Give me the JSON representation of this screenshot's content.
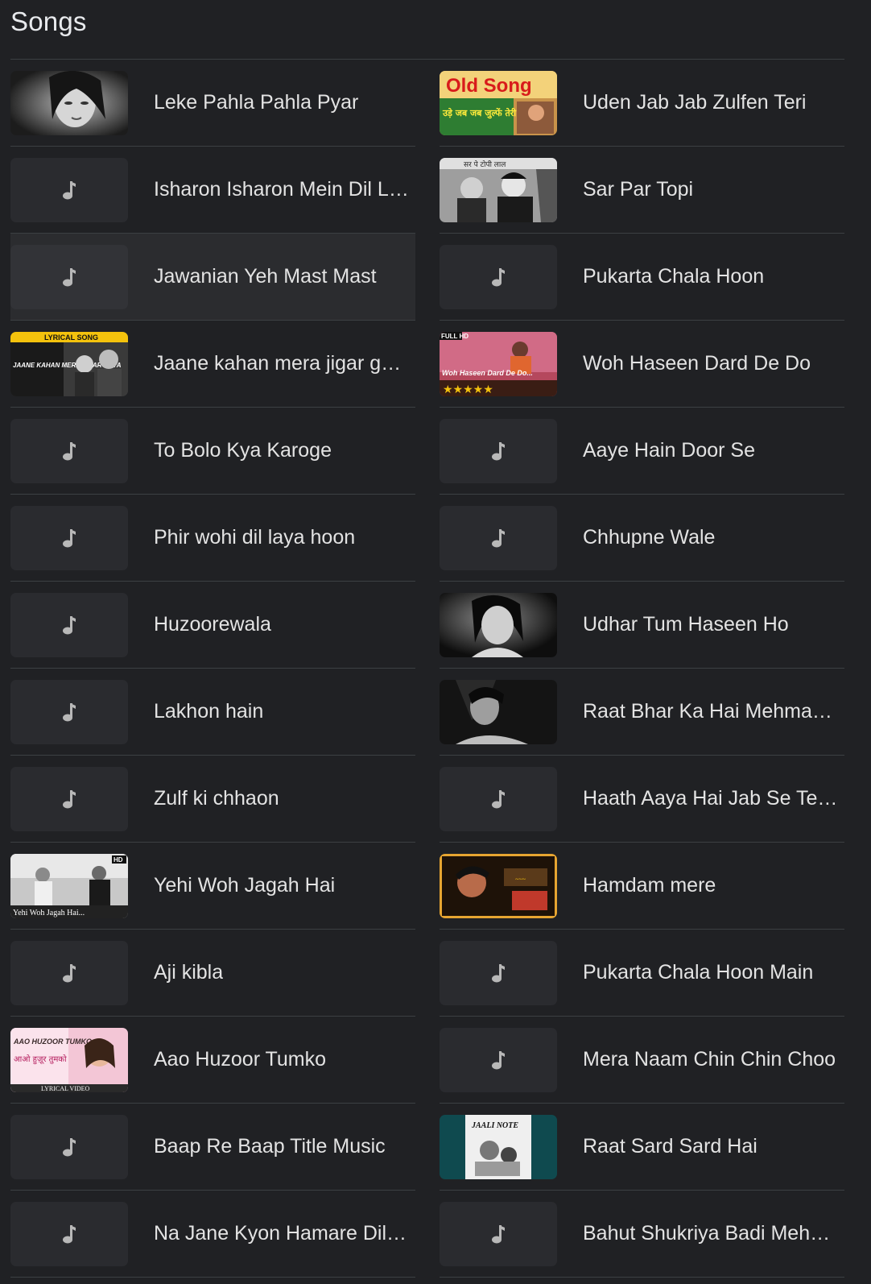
{
  "page": {
    "title": "Songs"
  },
  "songs_left": [
    {
      "title": "Leke Pahla Pahla Pyar"
    },
    {
      "title": "Isharon Isharon Mein Dil Le Jane Wale"
    },
    {
      "title": "Jawanian Yeh Mast Mast"
    },
    {
      "title": "Jaane kahan mera jigar gaya ji"
    },
    {
      "title": "To Bolo Kya Karoge"
    },
    {
      "title": "Phir wohi dil laya hoon"
    },
    {
      "title": "Huzoorewala"
    },
    {
      "title": "Lakhon hain"
    },
    {
      "title": "Zulf ki chhaon"
    },
    {
      "title": "Yehi Woh Jagah Hai"
    },
    {
      "title": "Aji kibla"
    },
    {
      "title": "Aao Huzoor Tumko"
    },
    {
      "title": "Baap Re Baap Title Music"
    },
    {
      "title": "Na Jane Kyon Hamare Dil Ko"
    }
  ],
  "songs_right": [
    {
      "title": "Uden Jab Jab Zulfen Teri"
    },
    {
      "title": "Sar Par Topi"
    },
    {
      "title": "Pukarta Chala Hoon"
    },
    {
      "title": "Woh Haseen Dard De Do"
    },
    {
      "title": "Aaye Hain Door Se"
    },
    {
      "title": "Chhupne Wale"
    },
    {
      "title": "Udhar Tum Haseen Ho"
    },
    {
      "title": "Raat Bhar Ka Hai Mehman Andhera"
    },
    {
      "title": "Haath Aaya Hai Jab Se Tera Haath"
    },
    {
      "title": "Hamdam mere"
    },
    {
      "title": "Pukarta Chala Hoon Main"
    },
    {
      "title": "Mera Naam Chin Chin Choo"
    },
    {
      "title": "Raat Sard Sard Hai"
    },
    {
      "title": "Bahut Shukriya Badi Meherbani"
    }
  ],
  "thumbnail_text": {
    "old_song_title": "Old Song",
    "old_song_sub": "उड़े जब जब जुल्फें तेरी",
    "sar_par_topi_caption": "सर पे टोपी लाल",
    "lyrical_song_banner": "LYRICAL SONG",
    "jaane_kahan_caption": "JAANE KAHAN MERA JIGAR GAYA",
    "full_hd_badge": "FULL HD",
    "woh_haseen_caption": "Woh Haseen Dard De Do...",
    "hd_badge": "HD",
    "yehi_woh_caption": "Yehi Woh Jagah Hai...",
    "aao_huzoor_caption": "AAO HUZOOR TUMKO",
    "aao_huzoor_hindi": "आओ हुज़ूर तुमको",
    "lyrical_video_badge": "LYRICAL VIDEO",
    "jaali_note_caption": "JAALI NOTE"
  },
  "colors": {
    "background": "#202124",
    "divider": "#3c4043",
    "text": "#e3e3e3",
    "placeholder": "#2a2b2f",
    "hover_row": "#2b2c2f"
  }
}
